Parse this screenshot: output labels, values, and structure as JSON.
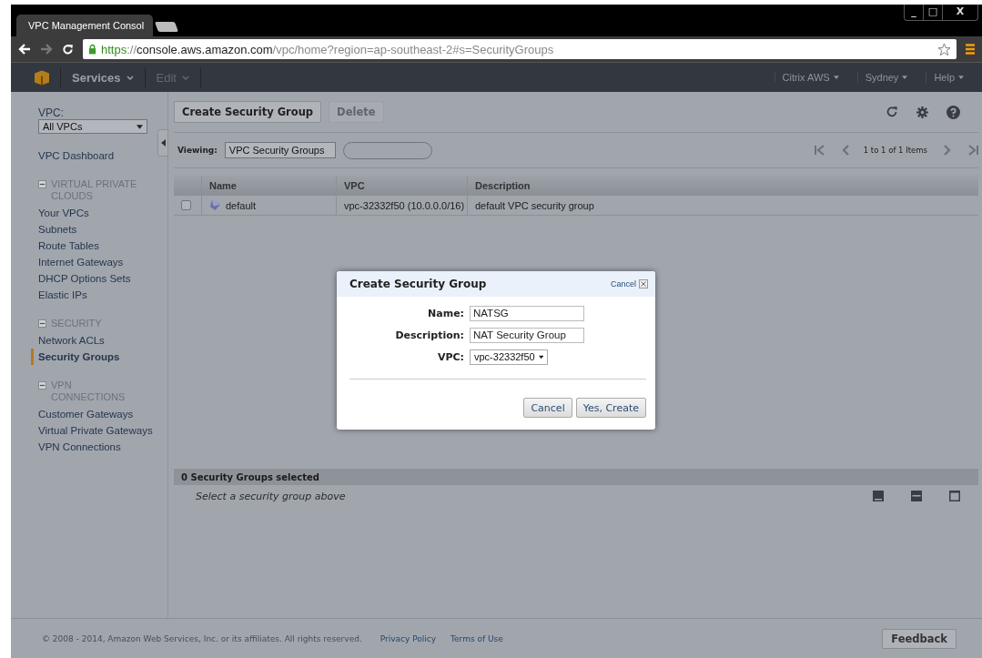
{
  "browser": {
    "tab_title": "VPC Management Consol",
    "url": {
      "scheme": "https",
      "separator": "://",
      "host": "console.aws.amazon.com",
      "path": "/vpc/home?region=ap-southeast-2#s=SecurityGroups"
    },
    "window_controls": [
      "_",
      "□",
      "X"
    ]
  },
  "nav": {
    "menus": [
      {
        "label": "Services",
        "disabled": false
      },
      {
        "label": "Edit",
        "disabled": true
      }
    ],
    "right_menus": [
      "Citrix AWS",
      "Sydney",
      "Help"
    ]
  },
  "sidebar": {
    "vpc_label": "VPC:",
    "vpc_select": "All VPCs",
    "dashboard": "VPC Dashboard",
    "sections": [
      {
        "title": "VIRTUAL PRIVATE CLOUDS",
        "expanded": true,
        "items": [
          {
            "label": "Your VPCs",
            "selected": false
          },
          {
            "label": "Subnets",
            "selected": false
          },
          {
            "label": "Route Tables",
            "selected": false
          },
          {
            "label": "Internet Gateways",
            "selected": false
          },
          {
            "label": "DHCP Options Sets",
            "selected": false
          },
          {
            "label": "Elastic IPs",
            "selected": false
          }
        ]
      },
      {
        "title": "SECURITY",
        "expanded": true,
        "items": [
          {
            "label": "Network ACLs",
            "selected": false
          },
          {
            "label": "Security Groups",
            "selected": true
          }
        ]
      },
      {
        "title": "VPN CONNECTIONS",
        "expanded": true,
        "items": [
          {
            "label": "Customer Gateways",
            "selected": false
          },
          {
            "label": "Virtual Private Gateways",
            "selected": false
          },
          {
            "label": "VPN Connections",
            "selected": false
          }
        ]
      }
    ]
  },
  "toolbar": {
    "buttons": [
      {
        "label": "Create Security Group",
        "disabled": false
      },
      {
        "label": "Delete",
        "disabled": true
      }
    ]
  },
  "filter": {
    "label": "Viewing:",
    "select": "VPC Security Groups"
  },
  "pagination": {
    "summary": "1 to 1 of 1 Items"
  },
  "table": {
    "columns": [
      "Name",
      "VPC",
      "Description"
    ],
    "rows": [
      {
        "checked": false,
        "name": "default",
        "vpc": "vpc-32332f50 (10.0.0.0/16)",
        "description": "default VPC security group"
      }
    ]
  },
  "details": {
    "title": "0 Security Groups selected",
    "hint": "Select a security group above"
  },
  "footer": {
    "copyright": "© 2008 - 2014, Amazon Web Services, Inc. or its affiliates. All rights reserved.",
    "links": [
      "Privacy Policy",
      "Terms of Use"
    ],
    "feedback": "Feedback"
  },
  "dialog": {
    "title": "Create Security Group",
    "close_label": "Cancel",
    "fields": [
      {
        "label": "Name:",
        "kind": "text",
        "value": "NATSG"
      },
      {
        "label": "Description:",
        "kind": "text",
        "value": "NAT Security Group"
      },
      {
        "label": "VPC:",
        "kind": "select",
        "value": "vpc-32332f50"
      }
    ],
    "buttons": [
      "Cancel",
      "Yes, Create"
    ]
  }
}
